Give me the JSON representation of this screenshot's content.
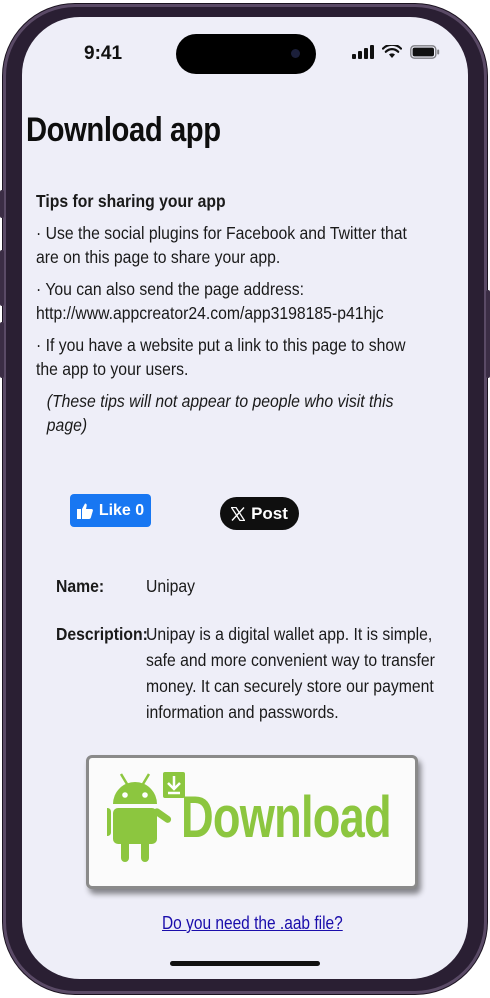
{
  "status_bar": {
    "time": "9:41"
  },
  "page": {
    "title": "Download app"
  },
  "tips": {
    "heading": "Tips for sharing your app",
    "items": [
      "· Use the social plugins for Facebook and Twitter that are on this page to share your app.",
      "· You can also send the page address: http://www.appcreator24.com/app3198185-p41hjc",
      "· If you have a website put a link to this page to show the app to your users."
    ],
    "note": "(These tips will not appear to people who visit this page)"
  },
  "social": {
    "like_label": "Like 0",
    "post_label": "Post"
  },
  "app_info": {
    "name_label": "Name:",
    "name_value": "Unipay",
    "description_label": "Description:",
    "description_value": "Unipay is a digital wallet app. It is simple, safe and more convenient way to transfer money. It can securely store our payment information and passwords."
  },
  "download": {
    "label": "Download",
    "color": "#8cc63f"
  },
  "aab_link": "Do you need the .aab file?",
  "colors": {
    "facebook": "#1877f2",
    "x_black": "#0f0f0f",
    "screen_bg": "#eeeef8",
    "link": "#1a0dab"
  }
}
